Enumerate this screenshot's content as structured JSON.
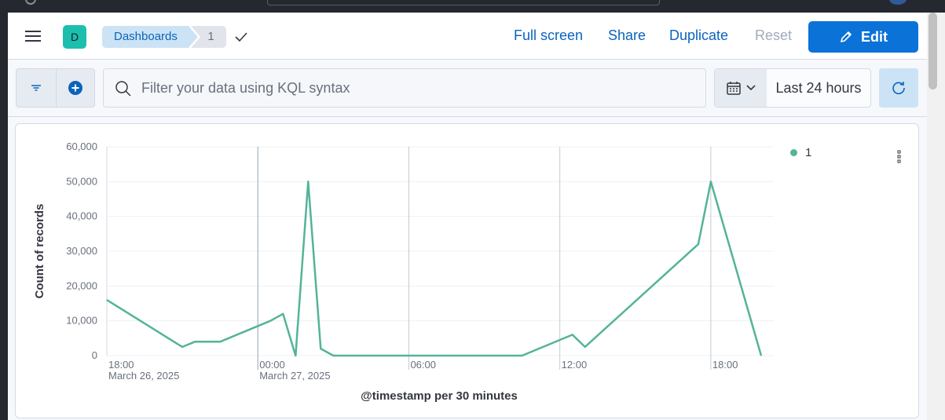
{
  "header": {
    "space_initial": "D",
    "breadcrumb_root": "Dashboards",
    "breadcrumb_current": "1",
    "actions": {
      "full_screen": "Full screen",
      "share": "Share",
      "duplicate": "Duplicate",
      "reset": "Reset",
      "edit": "Edit"
    }
  },
  "query_bar": {
    "placeholder": "Filter your data using KQL syntax",
    "time_range": "Last 24 hours"
  },
  "colors": {
    "accent": "#0b72d8",
    "series": "#54b399",
    "space_avatar": "#1cbfae"
  },
  "icons": [
    "menu-icon",
    "check-icon",
    "filter-icon",
    "plus-circle-icon",
    "search-icon",
    "calendar-icon",
    "chevron-down-icon",
    "refresh-icon",
    "pencil-icon",
    "vertical-dots-icon"
  ],
  "chart_data": {
    "type": "line",
    "xlabel": "@timestamp per 30 minutes",
    "ylabel": "Count of records",
    "ylim": [
      0,
      60000
    ],
    "yticks": [
      0,
      10000,
      20000,
      30000,
      40000,
      50000,
      60000
    ],
    "ytick_labels": [
      "0",
      "10,000",
      "20,000",
      "30,000",
      "40,000",
      "50,000",
      "60,000"
    ],
    "x_unit": "time",
    "xlim": [
      "2025-03-26 18:00",
      "2025-03-27 20:30"
    ],
    "xticks": [
      {
        "x": "2025-03-26 18:00",
        "line1": "18:00",
        "line2": "March 26, 2025"
      },
      {
        "x": "2025-03-27 00:00",
        "line1": "00:00",
        "line2": "March 27, 2025"
      },
      {
        "x": "2025-03-27 06:00",
        "line1": "06:00",
        "line2": ""
      },
      {
        "x": "2025-03-27 12:00",
        "line1": "12:00",
        "line2": ""
      },
      {
        "x": "2025-03-27 18:00",
        "line1": "18:00",
        "line2": ""
      }
    ],
    "legend": {
      "position": "top-right",
      "entries": [
        "1"
      ]
    },
    "grid": true,
    "series": [
      {
        "name": "1",
        "x": [
          "2025-03-26 18:00",
          "2025-03-26 21:00",
          "2025-03-26 21:30",
          "2025-03-26 22:30",
          "2025-03-27 00:30",
          "2025-03-27 01:00",
          "2025-03-27 01:30",
          "2025-03-27 02:00",
          "2025-03-27 02:30",
          "2025-03-27 03:00",
          "2025-03-27 03:30",
          "2025-03-27 06:00",
          "2025-03-27 10:30",
          "2025-03-27 12:30",
          "2025-03-27 13:00",
          "2025-03-27 17:30",
          "2025-03-27 18:00",
          "2025-03-27 20:00"
        ],
        "values": [
          16000,
          2500,
          4000,
          4000,
          10000,
          12000,
          0,
          50000,
          2000,
          0,
          0,
          0,
          0,
          6000,
          2500,
          32000,
          50000,
          0
        ]
      }
    ]
  }
}
